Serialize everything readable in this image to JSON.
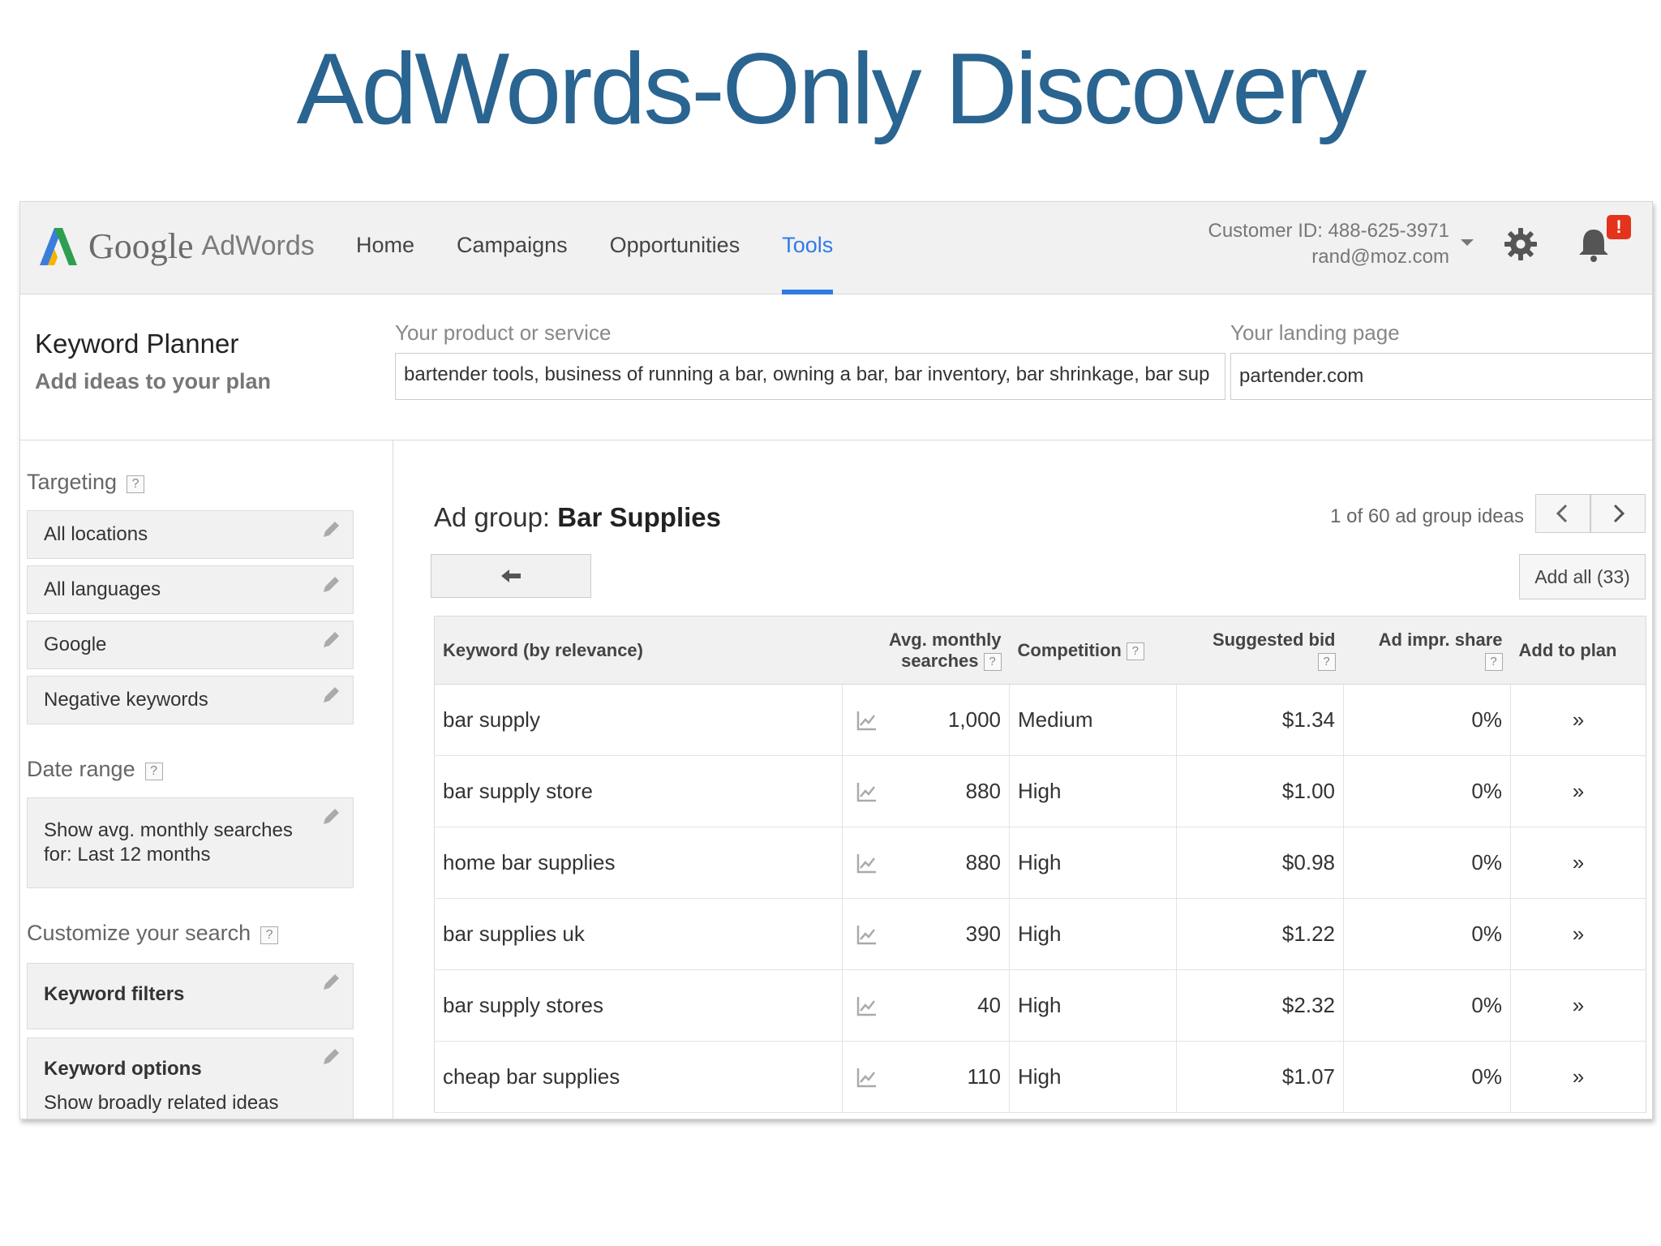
{
  "slide": {
    "title": "AdWords-Only Discovery"
  },
  "app": {
    "logo_google": "Google",
    "logo_adwords": "AdWords",
    "nav": [
      {
        "label": "Home"
      },
      {
        "label": "Campaigns"
      },
      {
        "label": "Opportunities"
      },
      {
        "label": "Tools",
        "active": true
      }
    ],
    "customer_id": "Customer ID: 488-625-3971",
    "email": "rand@moz.com",
    "alert_badge": "!",
    "icons": {
      "settings": "gear-icon",
      "notifications": "bell-icon"
    },
    "accent_color": "#2f7be5"
  },
  "planner": {
    "title": "Keyword Planner",
    "subtitle": "Add ideas to your plan",
    "product_label": "Your product or service",
    "product_value": "bartender tools, business of running a bar, owning a bar, bar inventory, bar shrinkage, bar sup",
    "landing_label": "Your landing page",
    "landing_value": "partender.com"
  },
  "sidebar": {
    "targeting_label": "Targeting",
    "targeting": [
      "All locations",
      "All languages",
      "Google",
      "Negative keywords"
    ],
    "date_label": "Date range",
    "date_line1": "Show avg. monthly searches",
    "date_line2": "for: Last 12 months",
    "customize_label": "Customize your search",
    "keyword_filters": "Keyword filters",
    "keyword_options": "Keyword options",
    "keyword_options_sub": "Show broadly related ideas",
    "help": "?"
  },
  "main": {
    "adgroup_prefix": "Ad group:",
    "adgroup_name": "Bar Supplies",
    "ideas_count": "1 of 60 ad group ideas",
    "add_all": "Add all (33)",
    "columns": {
      "keyword": "Keyword (by relevance)",
      "searches_1": "Avg. monthly",
      "searches_2": "searches",
      "competition": "Competition",
      "bid": "Suggested bid",
      "share": "Ad impr. share",
      "add": "Add to plan"
    },
    "rows": [
      {
        "keyword": "bar supply",
        "searches": "1,000",
        "competition": "Medium",
        "bid": "$1.34",
        "share": "0%"
      },
      {
        "keyword": "bar supply store",
        "searches": "880",
        "competition": "High",
        "bid": "$1.00",
        "share": "0%"
      },
      {
        "keyword": "home bar supplies",
        "searches": "880",
        "competition": "High",
        "bid": "$0.98",
        "share": "0%"
      },
      {
        "keyword": "bar supplies uk",
        "searches": "390",
        "competition": "High",
        "bid": "$1.22",
        "share": "0%"
      },
      {
        "keyword": "bar supply stores",
        "searches": "40",
        "competition": "High",
        "bid": "$2.32",
        "share": "0%"
      },
      {
        "keyword": "cheap bar supplies",
        "searches": "110",
        "competition": "High",
        "bid": "$1.07",
        "share": "0%"
      }
    ],
    "add_glyph": "»"
  }
}
